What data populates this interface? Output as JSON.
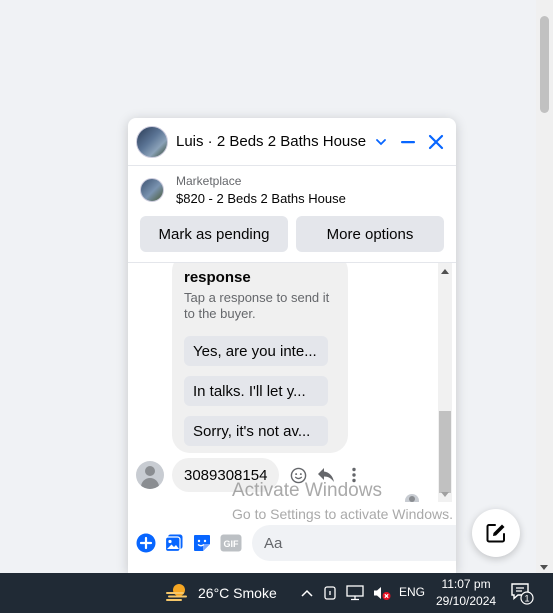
{
  "chat": {
    "title": "Luis · 2 Beds 2 Baths House",
    "listing": {
      "label": "Marketplace",
      "name": "$820 - 2 Beds 2 Baths House"
    },
    "actions": {
      "mark_pending": "Mark as pending",
      "more_options": "More options"
    },
    "response_card": {
      "title": "response",
      "subtitle": "Tap a response to send it to the buyer.",
      "replies": [
        "Yes, are you inte...",
        "In talks. I'll let y...",
        "Sorry, it's not av..."
      ]
    },
    "last_message": "3089308154",
    "composer": {
      "placeholder": "Aa"
    },
    "accent": "#0866ff"
  },
  "watermark": {
    "line1": "Activate Windows",
    "line2": "Go to Settings to activate Windows."
  },
  "taskbar": {
    "weather": "26°C  Smoke",
    "language": "ENG",
    "time": "11:07 pm",
    "date": "29/10/2024",
    "notification_count": "1"
  }
}
